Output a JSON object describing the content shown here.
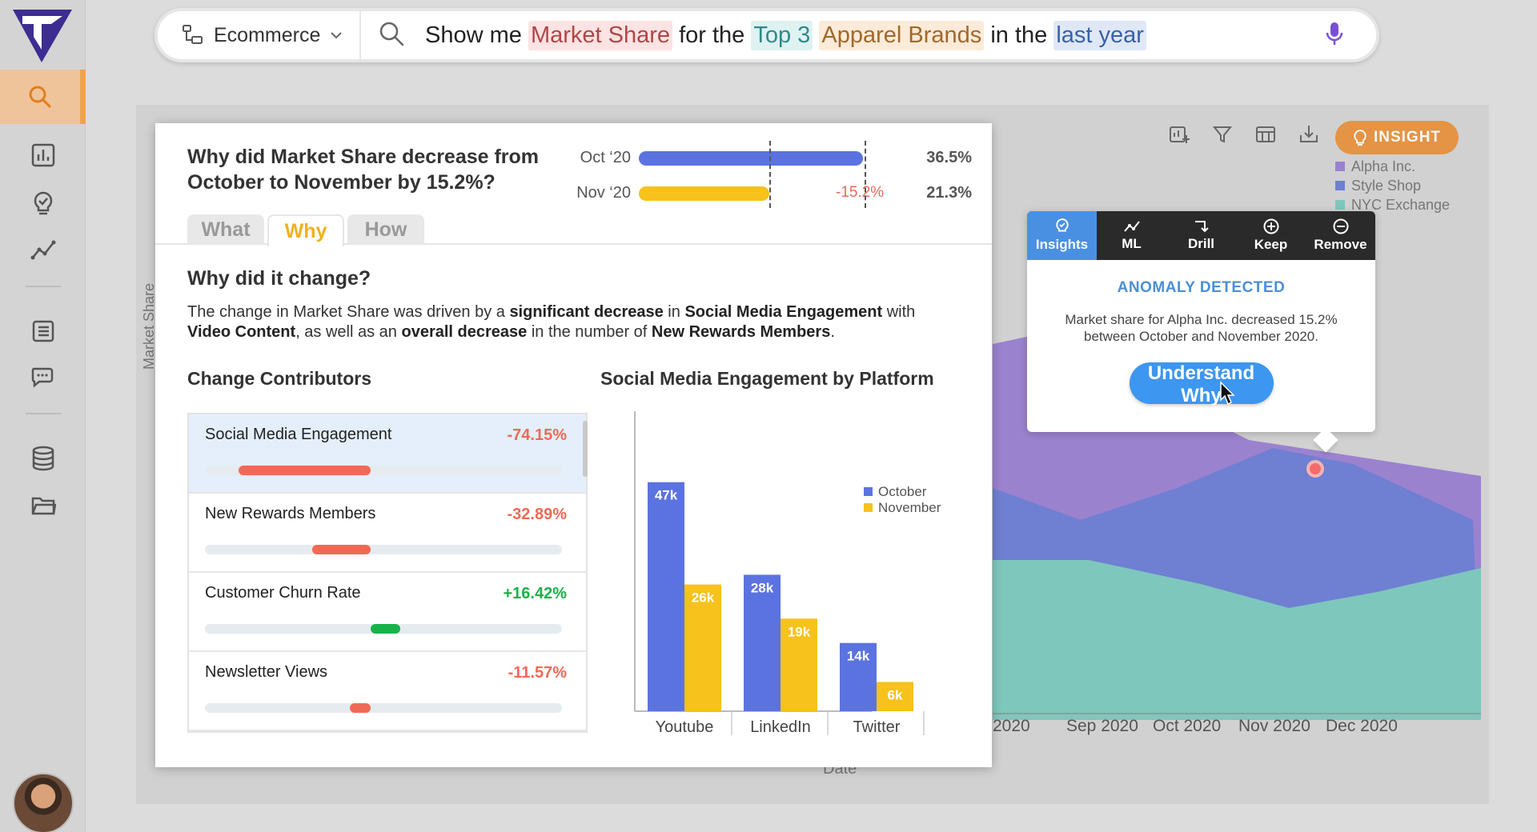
{
  "search": {
    "dataset": "Ecommerce",
    "query": [
      {
        "text": "Show me ",
        "kind": "plain"
      },
      {
        "text": "Market Share",
        "kind": "measure"
      },
      {
        "text": " for the ",
        "kind": "plain"
      },
      {
        "text": "Top 3",
        "kind": "top"
      },
      {
        "text": " ",
        "kind": "plain"
      },
      {
        "text": "Apparel Brands",
        "kind": "cat"
      },
      {
        "text": " in the ",
        "kind": "plain"
      },
      {
        "text": "last year",
        "kind": "date"
      }
    ]
  },
  "dashboard": {
    "insight_label": "INSIGHT",
    "legend": [
      {
        "name": "Alpha Inc.",
        "color": "#9b82cf"
      },
      {
        "name": "Style Shop",
        "color": "#6f7fd2"
      },
      {
        "name": "NYC Exchange",
        "color": "#7ec7bd"
      }
    ],
    "x_ticks": [
      "2020",
      "Sep 2020",
      "Oct 2020",
      "Nov 2020",
      "Dec 2020"
    ],
    "y_label": "Market Share",
    "x_label": "Date"
  },
  "anomaly": {
    "tabs": [
      "Insights",
      "ML",
      "Drill",
      "Keep",
      "Remove"
    ],
    "title": "ANOMALY DETECTED",
    "text": "Market share for Alpha Inc. decreased 15.2% between October and November 2020.",
    "button": "Understand Why"
  },
  "panel": {
    "question": "Why did Market Share decrease from October to November by 15.2%?",
    "tabs": [
      "What",
      "Why",
      "How"
    ],
    "active_tab": "Why",
    "comparison": [
      {
        "label": "Oct ‘20",
        "value": "36.5%",
        "share": 36.5,
        "color": "#5b73e0"
      },
      {
        "label": "Nov ‘20",
        "value": "21.3%",
        "share": 21.3,
        "color": "#f7c21b",
        "delta": "-15.2%"
      }
    ],
    "why_heading": "Why did it change?",
    "why_parts": [
      {
        "t": "The change in Market Share was driven by a ",
        "b": false
      },
      {
        "t": "significant decrease",
        "b": true
      },
      {
        "t": " in ",
        "b": false
      },
      {
        "t": "Social Media Engagement",
        "b": true
      },
      {
        "t": " with ",
        "b": false
      },
      {
        "t": "Video Content",
        "b": true
      },
      {
        "t": ", as well as an ",
        "b": false
      },
      {
        "t": "overall decrease",
        "b": true
      },
      {
        "t": " in the number of ",
        "b": false
      },
      {
        "t": "New Rewards Members",
        "b": true
      },
      {
        "t": ".",
        "b": false
      }
    ],
    "contributors_heading": "Change Contributors",
    "contributors": [
      {
        "name": "Social Media Engagement",
        "value": "-74.15%",
        "positive": false
      },
      {
        "name": "New Rewards Members",
        "value": "-32.89%",
        "positive": false
      },
      {
        "name": "Customer Churn Rate",
        "value": "+16.42%",
        "positive": true
      },
      {
        "name": "Newsletter Views",
        "value": "-11.57%",
        "positive": false
      }
    ],
    "chart_heading": "Social Media Engagement by Platform"
  },
  "chart_data": {
    "type": "bar",
    "title": "Social Media Engagement by Platform",
    "categories": [
      "Youtube",
      "LinkedIn",
      "Twitter"
    ],
    "series": [
      {
        "name": "October",
        "values": [
          47,
          28,
          14
        ],
        "labels": [
          "47k",
          "28k",
          "14k"
        ],
        "color": "#5b73e0"
      },
      {
        "name": "November",
        "values": [
          26,
          19,
          6
        ],
        "labels": [
          "26k",
          "19k",
          "6k"
        ],
        "color": "#f7c21b"
      }
    ],
    "ylim": [
      0,
      55
    ]
  },
  "colors": {
    "accent": "#f1a24a",
    "negative": "#ef6a55",
    "positive": "#17b34a",
    "highlight_blue": "#4a90e2"
  }
}
